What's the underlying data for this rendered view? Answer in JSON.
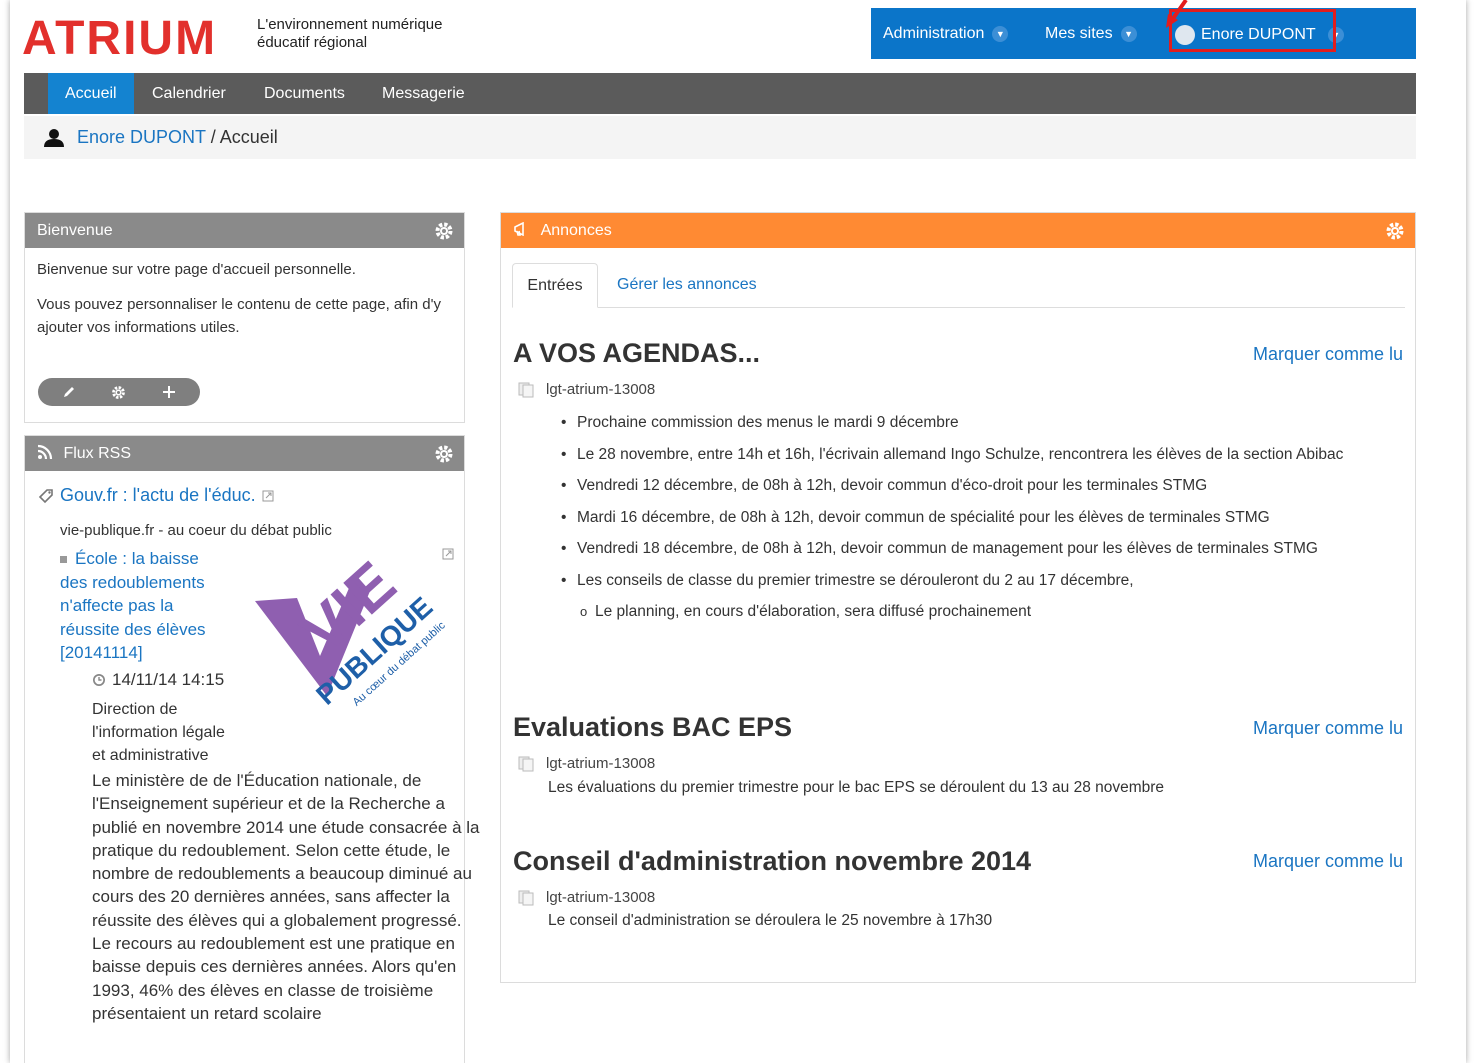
{
  "logo": {
    "text": "ATRIUM",
    "tagline_1": "L'environnement numérique",
    "tagline_2": "éducatif régional"
  },
  "topbar": {
    "administration": "Administration",
    "mes_sites": "Mes sites",
    "user": "Enore DUPONT",
    "help": "?"
  },
  "nav": {
    "tabs": [
      "Accueil",
      "Calendrier",
      "Documents",
      "Messagerie"
    ]
  },
  "breadcrumb": {
    "user": "Enore DUPONT",
    "separator": "/",
    "page": "Accueil"
  },
  "bienvenue": {
    "title": "Bienvenue",
    "line1": "Bienvenue sur votre page d'accueil personnelle.",
    "line2": "Vous pouvez personnaliser le contenu de cette page, afin d'y ajouter vos informations utiles."
  },
  "rss": {
    "title": "Flux RSS",
    "source": "Gouv.fr : l'actu de l'éduc.",
    "subtitle": "vie-publique.fr - au coeur du débat public",
    "article_title": "École : la baisse des redoublements n'affecte pas la réussite des élèves [20141114]",
    "date": "14/11/14 14:15",
    "credit": "Direction de l'information légale et administrative",
    "description": "Le ministère de de l'Éducation nationale, de l'Enseignement supérieur et de la Recherche a publié en novembre 2014 une étude consacrée à la pratique du redoublement. Selon cette étude, le nombre de redoublements a beaucoup diminué au cours des 20 dernières années, sans affecter la réussite des élèves qui a globalement progressé. Le recours au redoublement est une pratique en baisse depuis ces dernières années. Alors qu'en 1993, 46% des élèves en classe de troisième présentaient un retard scolaire",
    "logo_vie": "VIE",
    "logo_publique": "PUBLIQUE",
    "logo_tag": "Au cœur du débat public"
  },
  "annonces": {
    "title": "Annonces",
    "tab_entries": "Entrées",
    "tab_manage": "Gérer les annonces",
    "mark_read": "Marquer comme lu",
    "items": [
      {
        "title": "A VOS AGENDAS...",
        "source": "lgt-atrium-13008",
        "bullets": [
          "Prochaine commission des menus le mardi 9 décembre",
          "Le 28 novembre, entre 14h et 16h, l'écrivain allemand Ingo Schulze, rencontrera les élèves de la section Abibac",
          "Vendredi 12 décembre, de 08h à 12h, devoir commun d'éco-droit pour les terminales STMG",
          "Mardi 16 décembre, de 08h à 12h, devoir commun de spécialité pour les élèves de terminales STMG",
          "Vendredi 18 décembre, de 08h à 12h, devoir commun de management pour les élèves de terminales STMG",
          "Les conseils de classe du premier trimestre se dérouleront du 2 au 17 décembre,"
        ],
        "sub_bullet": "Le planning, en cours d'élaboration, sera diffusé prochainement"
      },
      {
        "title": "Evaluations BAC EPS",
        "source": "lgt-atrium-13008",
        "text": "Les évaluations du premier trimestre pour le bac EPS se déroulent du 13 au 28 novembre"
      },
      {
        "title": "Conseil d'administration novembre 2014",
        "source": "lgt-atrium-13008",
        "text": "Le conseil d'administration se déroulera le 25 novembre à 17h30"
      }
    ]
  },
  "colors": {
    "brand_red": "#e2302c",
    "topbar_blue": "#0b75c9",
    "nav_grey": "#5b5b5b",
    "active_tab": "#1483d0",
    "annonces_orange": "#ff8a33",
    "link_blue": "#1a75c2"
  }
}
